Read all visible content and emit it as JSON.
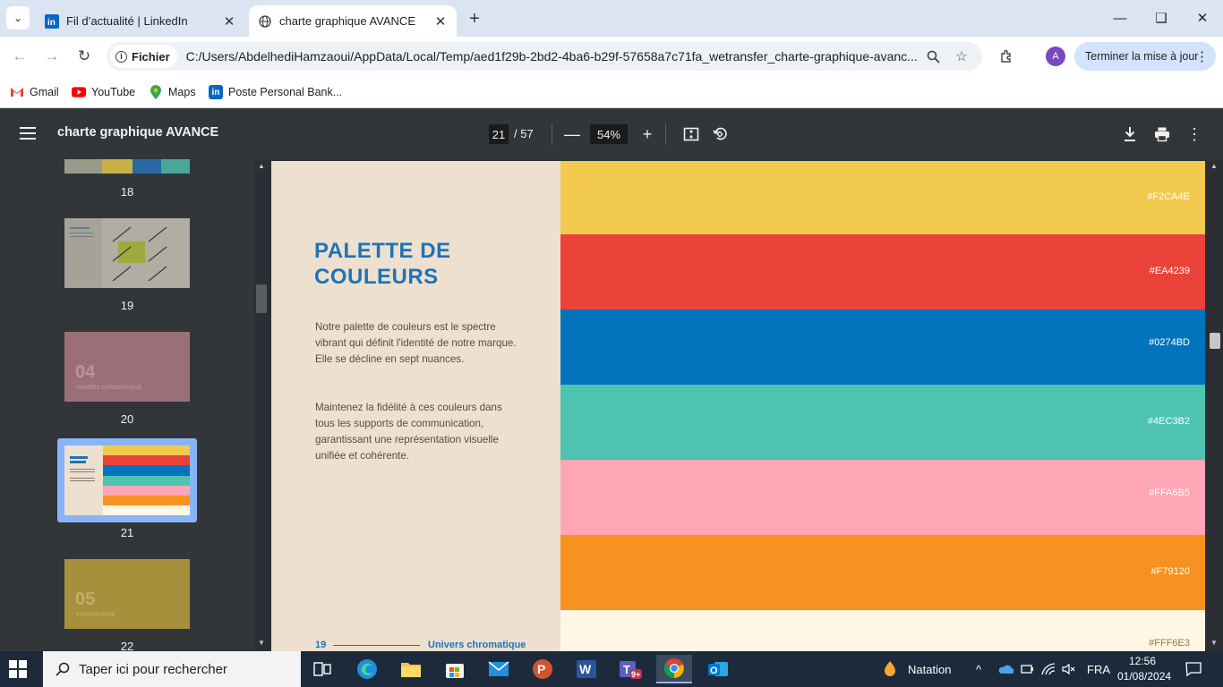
{
  "browser": {
    "tabs": [
      {
        "title": "Fil d’actualité | LinkedIn",
        "icon": "linkedin-icon",
        "active": false
      },
      {
        "title": "charte graphique AVANCE",
        "icon": "globe-icon",
        "active": true
      }
    ],
    "address": {
      "chip_label": "Fichier",
      "url": "C:/Users/AbdelhediHamzaoui/AppData/Local/Temp/aed1f29b-2bd2-4ba6-b29f-57658a7c71fa_wetransfer_charte-graphique-avanc..."
    },
    "profile_initial": "A",
    "update_button": "Terminer la mise à jour",
    "bookmarks": [
      {
        "label": "Gmail",
        "icon": "gmail-icon",
        "color": "#ea4335"
      },
      {
        "label": "YouTube",
        "icon": "youtube-icon",
        "color": "#ff0000"
      },
      {
        "label": "Maps",
        "icon": "maps-icon",
        "color": "#34a853"
      },
      {
        "label": "Poste Personal Bank...",
        "icon": "linkedin-icon",
        "color": "#0a66c2"
      }
    ]
  },
  "pdf": {
    "title": "charte graphique AVANCE",
    "current_page": "21",
    "total_pages": "/ 57",
    "zoom": "54%",
    "thumbnails": [
      {
        "num": "18"
      },
      {
        "num": "19"
      },
      {
        "num": "20",
        "big": "04",
        "caption": "UNIVERS CHROMATIQUE"
      },
      {
        "num": "21"
      },
      {
        "num": "22",
        "big": "05",
        "caption": "TYPOGRAPHIE"
      }
    ]
  },
  "page": {
    "title_line1": "PALETTE DE",
    "title_line2": "COULEURS",
    "para1": "Notre palette de couleurs est le spectre vibrant qui définit l'identité de notre marque. Elle se décline en sept nuances.",
    "para2": "Maintenez la fidélité à ces couleurs dans tous les supports de communication, garantissant une représentation visuelle unifiée et cohérente.",
    "footer_num": "19",
    "footer_label": "Univers chromatique",
    "colors": [
      {
        "hex": "#F2CA4E",
        "fill": "#f2ca4e"
      },
      {
        "hex": "#EA4239",
        "fill": "#ea4239"
      },
      {
        "hex": "#0274BD",
        "fill": "#0274bd"
      },
      {
        "hex": "#4EC3B2",
        "fill": "#4ec3b2"
      },
      {
        "hex": "#FFA6B5",
        "fill": "#ffa6b5"
      },
      {
        "hex": "#F79120",
        "fill": "#f79120"
      },
      {
        "hex": "#FFF6E3",
        "fill": "#fff6e3"
      }
    ]
  },
  "taskbar": {
    "search_placeholder": "Taper ici pour rechercher",
    "weather": "Natation",
    "language": "FRA",
    "time": "12:56",
    "date": "01/08/2024"
  }
}
